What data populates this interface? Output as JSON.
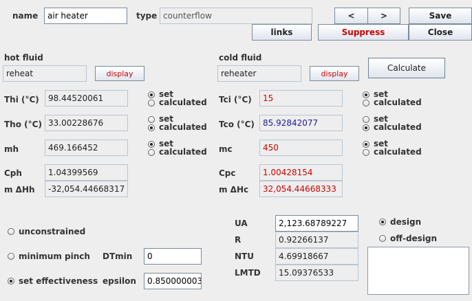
{
  "header": {
    "name_label": "name",
    "name_value": "air heater",
    "type_label": "type",
    "type_value": "counterflow",
    "prev_label": "<",
    "next_label": ">",
    "save_label": "Save",
    "links_label": "links",
    "suppress_label": "Suppress",
    "close_label": "Close"
  },
  "hot": {
    "title": "hot fluid",
    "fluid": "reheat",
    "display_label": "display",
    "thi_label": "Thi (°C)",
    "thi_value": "98.44520061",
    "tho_label": "Tho (°C)",
    "tho_value": "33.00228676",
    "mh_label": "mh",
    "mh_value": "469.166452",
    "cph_label": "Cph",
    "cph_value": "1.04399569",
    "dh_label": "m ΔHh",
    "dh_value": "-32,054.44668317"
  },
  "cold": {
    "title": "cold fluid",
    "fluid": "reheater",
    "display_label": "display",
    "calculate_label": "Calculate",
    "tci_label": "Tci (°C)",
    "tci_value": "15",
    "tco_label": "Tco (°C)",
    "tco_value": "85.92842077",
    "mc_label": "mc",
    "mc_value": "450",
    "cpc_label": "Cpc",
    "cpc_value": "1.00428154",
    "dh_label": "m ΔHc",
    "dh_value": "32,054.44668333"
  },
  "radio": {
    "set": "set",
    "calculated": "calculated"
  },
  "mode": {
    "unconstrained": "unconstrained",
    "minimum_pinch": "minimum pinch",
    "set_effectiveness": "set effectiveness",
    "dtmin_label": "DTmin",
    "dtmin_value": "0",
    "epsilon_label": "epsilon",
    "epsilon_value": "0.850000003"
  },
  "results": {
    "ua_label": "UA",
    "ua_value": "2,123.68789227",
    "r_label": "R",
    "r_value": "0.92266137",
    "ntu_label": "NTU",
    "ntu_value": "4.69918667",
    "lmtd_label": "LMTD",
    "lmtd_value": "15.09376533",
    "design_label": "design",
    "offdesign_label": "off-design"
  }
}
